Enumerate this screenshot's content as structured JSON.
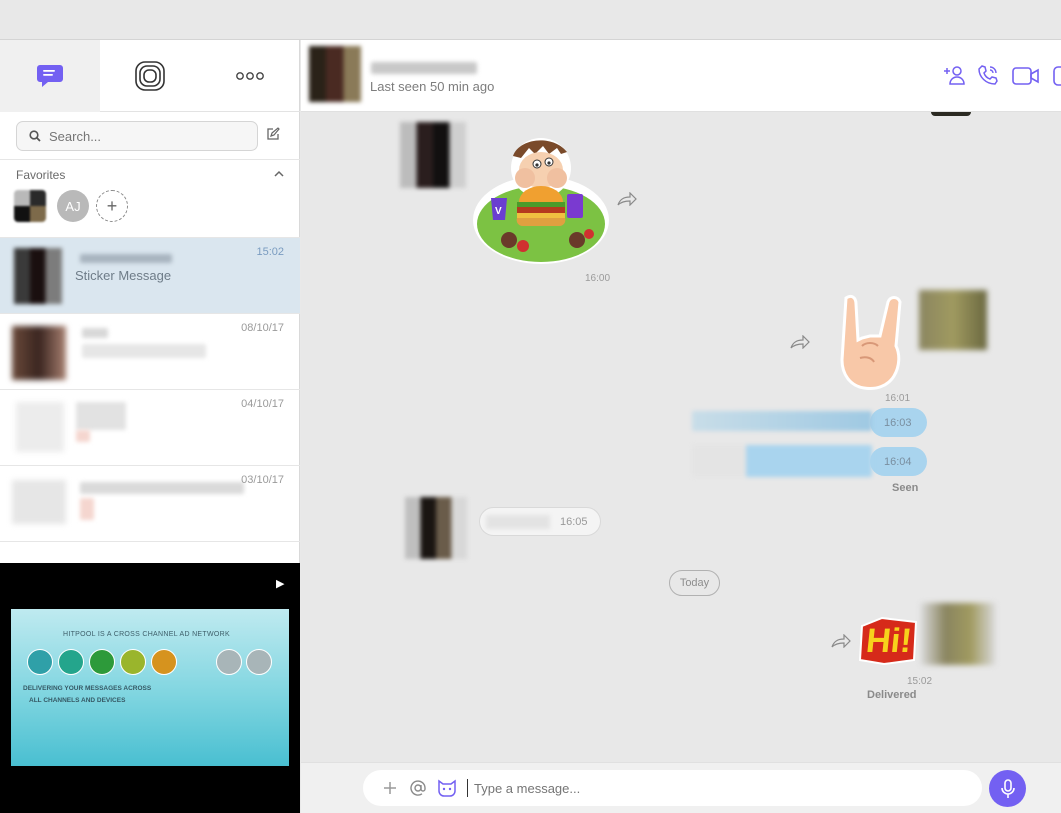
{
  "sidebar": {
    "search_placeholder": "Search...",
    "favorites_title": "Favorites",
    "favorite_initials": "AJ",
    "add_favorite_symbol": "+",
    "chats": [
      {
        "time": "15:02",
        "subtitle": "Sticker Message"
      },
      {
        "time": "08/10/17"
      },
      {
        "time": "04/10/17"
      },
      {
        "time": "03/10/17"
      }
    ],
    "video": {
      "title": "HITPOOL IS A CROSS CHANNEL AD NETWORK",
      "line1": "DELIVERING YOUR MESSAGES ACROSS",
      "line2": "ALL CHANNELS AND DEVICES",
      "play_symbol": "▶"
    }
  },
  "header": {
    "last_seen": "Last seen 50 min ago"
  },
  "messages": {
    "burger_sticker_time": "16:00",
    "horns_sticker_time": "16:01",
    "out_msg1_time": "16:03",
    "out_msg2_time": "16:04",
    "seen_status": "Seen",
    "in_msg_time": "16:05",
    "date_divider": "Today",
    "hi_sticker_time": "15:02",
    "hi_sticker_text": "Hi!",
    "delivered_status": "Delivered"
  },
  "composer": {
    "placeholder": "Type a message..."
  },
  "colors": {
    "accent": "#7360f2",
    "outgoing_bubble": "#a9d4ee",
    "active_chat": "#dae6ef"
  },
  "icons": [
    "chat-icon",
    "stories-icon",
    "more-icon",
    "search-icon",
    "compose-icon",
    "chevron-up-icon",
    "add-participant-icon",
    "call-icon",
    "video-call-icon",
    "forward-icon",
    "plus-icon",
    "mention-icon",
    "sticker-icon",
    "microphone-icon"
  ]
}
